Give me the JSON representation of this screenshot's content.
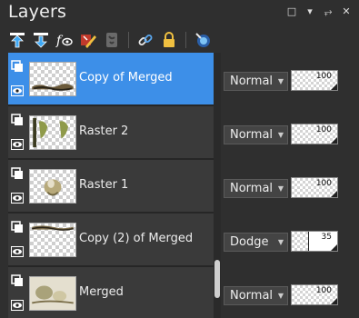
{
  "panel": {
    "title": "Layers"
  },
  "window_controls": [
    "restore-icon",
    "dropdown-icon",
    "pin-icon",
    "close-icon"
  ],
  "toolbar": {
    "tools": [
      "new-raster-layer-icon",
      "new-vector-layer-icon",
      "fx-icon",
      "edit-selection-icon",
      "mask-icon",
      "link-icon",
      "lock-icon",
      "color-wheel-icon"
    ]
  },
  "layers": [
    {
      "name": "Copy of Merged",
      "blend": "Normal",
      "opacity": "100",
      "opacity_level": 100,
      "selected": true
    },
    {
      "name": "Raster 2",
      "blend": "Normal",
      "opacity": "100",
      "opacity_level": 100,
      "selected": false
    },
    {
      "name": "Raster 1",
      "blend": "Normal",
      "opacity": "100",
      "opacity_level": 100,
      "selected": false
    },
    {
      "name": "Copy (2) of Merged",
      "blend": "Dodge",
      "opacity": "35",
      "opacity_level": 35,
      "selected": false
    },
    {
      "name": "Merged",
      "blend": "Normal",
      "opacity": "100",
      "opacity_level": 100,
      "selected": false
    }
  ],
  "colors": {
    "selection": "#3d8fe8",
    "panel_bg": "#2f2f2f",
    "row_bg": "#3a3a3a"
  }
}
